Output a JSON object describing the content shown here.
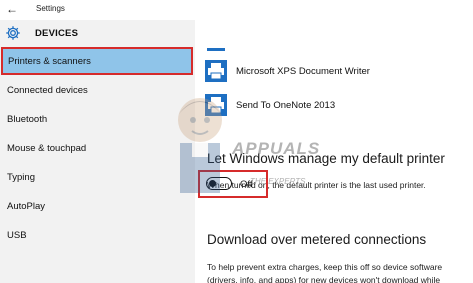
{
  "window": {
    "title": "Settings"
  },
  "sidebar": {
    "header": "DEVICES",
    "items": [
      {
        "label": "Printers & scanners",
        "selected": true
      },
      {
        "label": "Connected devices"
      },
      {
        "label": "Bluetooth"
      },
      {
        "label": "Mouse & touchpad"
      },
      {
        "label": "Typing"
      },
      {
        "label": "AutoPlay"
      },
      {
        "label": "USB"
      }
    ]
  },
  "content": {
    "printers": [
      {
        "name": "Microsoft XPS Document Writer",
        "icon": "printer-icon"
      },
      {
        "name": "Send To OneNote 2013",
        "icon": "printer-icon"
      }
    ],
    "default_printer": {
      "title": "Let Windows manage my default printer",
      "description": "When turned on, the default printer is the last used printer.",
      "toggle_state": "Off"
    },
    "metered": {
      "title": "Download over metered connections",
      "description_line1": "To help prevent extra charges, keep this off so device software",
      "description_line2": "(drivers, info, and apps) for new devices won't download while"
    }
  },
  "watermark": {
    "text": "APPUALS",
    "subtext": "THE EXPERTS"
  },
  "colors": {
    "accent": "#1e6fc2",
    "selected_bg": "#8fc4e9",
    "highlight_border": "#d62b2b",
    "sidebar_bg": "#f2f2f2"
  }
}
